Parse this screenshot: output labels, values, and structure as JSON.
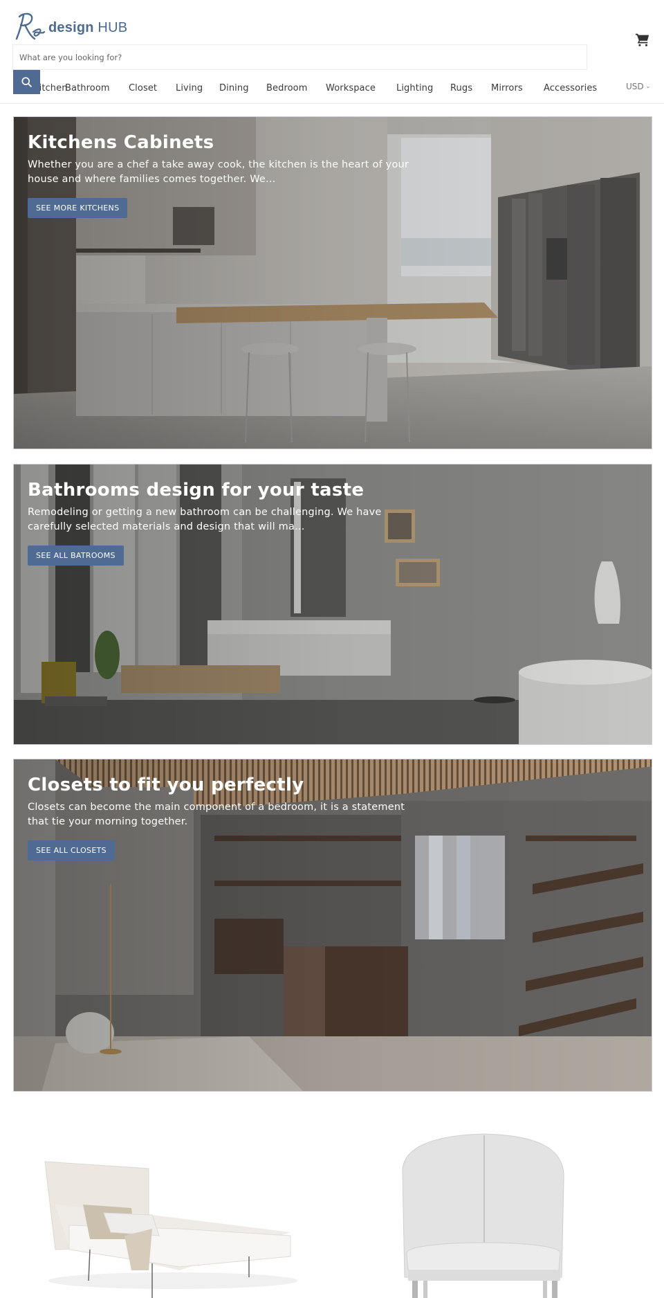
{
  "header": {
    "logo": {
      "script": "Re",
      "bold": "design",
      "light": "HUB"
    },
    "search": {
      "placeholder": "What are you looking for?",
      "value": ""
    },
    "icons": {
      "search": "search-icon",
      "cart": "cart-icon",
      "currency_chevron": "chevron-down-icon"
    },
    "currency": "USD",
    "nav": [
      {
        "label": "Kitchen",
        "visible_text": "n"
      },
      {
        "label": "Bathroom"
      },
      {
        "label": "Closet"
      },
      {
        "label": "Living"
      },
      {
        "label": "Dining"
      },
      {
        "label": "Bedroom"
      },
      {
        "label": "Workspace"
      },
      {
        "label": "Lighting"
      },
      {
        "label": "Rugs"
      },
      {
        "label": "Mirrors"
      },
      {
        "label": "Accessories"
      }
    ]
  },
  "colors": {
    "brand": "#4f6b93",
    "logo": "#4d6a91",
    "text": "#3a3a3a"
  },
  "sections": [
    {
      "id": "kitchen",
      "title": "Kitchens Cabinets",
      "text": "Whether you are a chef a take away cook, the kitchen is the heart of your house and where families comes together. We...",
      "button": "SEE MORE KITCHENS"
    },
    {
      "id": "bath",
      "title": "Bathrooms design for your taste",
      "text": "Remodeling or getting a new bathroom can be challenging. We have carefully selected materials and design that will ma...",
      "button": "SEE ALL BATROOMS"
    },
    {
      "id": "closet",
      "title": "Closets to fit you perfectly",
      "text": "Closets can become the main component of a bedroom, it is a statement that tie your morning together.",
      "button": "SEE ALL CLOSETS"
    }
  ],
  "products": [
    {
      "name": "bed"
    },
    {
      "name": "chair"
    }
  ]
}
